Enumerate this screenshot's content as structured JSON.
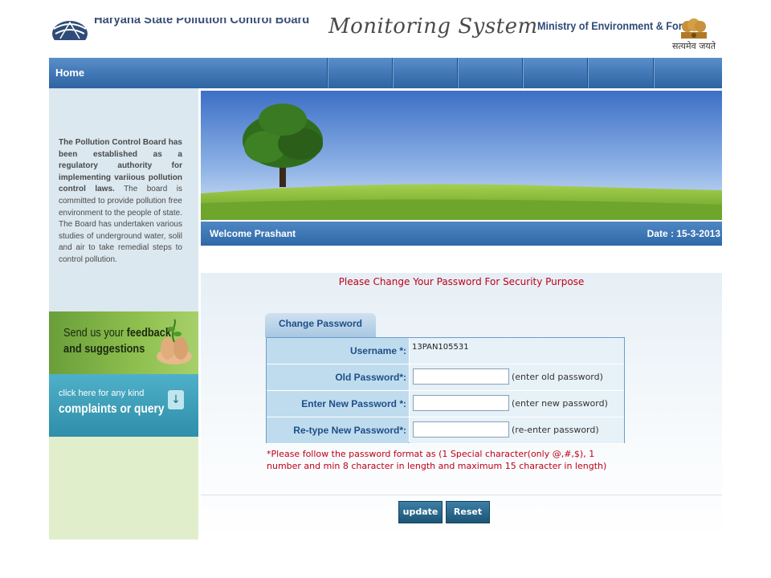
{
  "header": {
    "board_title": "Haryana State Pollution Control Board",
    "system_title": "Monitoring System",
    "ministry": "Ministry of Environment & Forest",
    "motto": "सत्यमेव जयते"
  },
  "nav": {
    "items": [
      "Home"
    ]
  },
  "sidebar": {
    "about_bold": "The Pollution Control Board has been established as a regulatory authority for implementing variious pollution control laws.",
    "about_rest": " The board is committed to provide pollution free environment to the people of state. The Board has undertaken various studies of underground water, solil and air to take remedial steps to control pollution.",
    "feedback_line1_a": "Send us your ",
    "feedback_line1_b": "feedback",
    "feedback_line2": "and suggestions",
    "complaints_line1": "click here for any kind",
    "complaints_line2": "complaints or query"
  },
  "welcome": {
    "message": "Welcome Prashant",
    "date": "Date : 15-3-2013"
  },
  "form": {
    "security_message": "Please Change Your Password For Security Purpose",
    "tab_label": "Change Password",
    "username_label": "Username *:",
    "username_value": "13PAN105531",
    "old_password_label": "Old Password*:",
    "old_password_hint": "(enter old password)",
    "new_password_label": "Enter New Password *:",
    "new_password_hint": "(enter new password)",
    "retype_password_label": "Re-type New Password*:",
    "retype_password_hint": "(re-enter password)",
    "format_note": "*Please follow the password format as (1 Special character(only @,#,$), 1 number and min 8 character in length and maximum 15 character in length)",
    "update_label": "update",
    "reset_label": "Reset"
  },
  "colors": {
    "nav_blue": "#3f76b4",
    "label_blue": "#1f4e87",
    "alert_red": "#c0001a",
    "sidebar_bg": "#dbe8ef"
  }
}
